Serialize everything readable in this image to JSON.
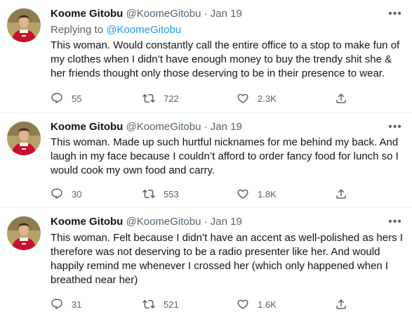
{
  "tweets": [
    {
      "name": "Koome Gitobu",
      "handle": "@KoomeGitobu",
      "date": "Jan 19",
      "replying_label": "Replying to ",
      "replying_handle": "@KoomeGitobu",
      "text": "This woman. Would constantly call the entire office to a stop to make fun of my clothes when I didn’t have enough money to buy the trendy shit she & her friends thought only those deserving to be in their presence to wear.",
      "replies": "55",
      "retweets": "722",
      "likes": "2.3K"
    },
    {
      "name": "Koome Gitobu",
      "handle": "@KoomeGitobu",
      "date": "Jan 19",
      "text": "This woman. Made up such hurtful nicknames for me behind my back. And laugh in my face because I couldn’t afford to order fancy food for lunch so I would cook my own food and carry.",
      "replies": "30",
      "retweets": "553",
      "likes": "1.8K"
    },
    {
      "name": "Koome Gitobu",
      "handle": "@KoomeGitobu",
      "date": "Jan 19",
      "text": "This woman. Felt because I didn’t have an accent as well-polished as hers I therefore was not deserving to be a radio presenter like her. And would happily remind me whenever I crossed her (which only happened when I breathed near her)",
      "replies": "31",
      "retweets": "521",
      "likes": "1.6K"
    }
  ],
  "separator": "·",
  "icons": [
    "more-icon",
    "reply-icon",
    "retweet-icon",
    "like-icon",
    "share-icon"
  ],
  "colors": {
    "name": "#0f1419",
    "meta": "#536471",
    "link": "#1d9bf0",
    "jersey": "#c8102e"
  }
}
